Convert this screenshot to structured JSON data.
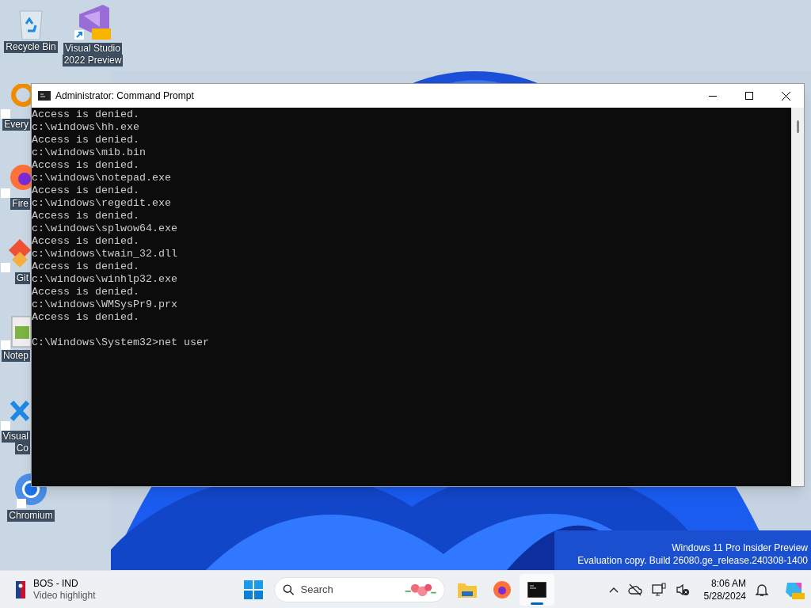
{
  "desktop_icons": [
    {
      "kind": "recycle",
      "lines": [
        "Recycle Bin"
      ]
    },
    {
      "kind": "vs",
      "lines": [
        "Visual Studio",
        "2022 Preview"
      ]
    },
    {
      "kind": "everything",
      "lines": [
        "Every"
      ]
    },
    {
      "kind": "firefox",
      "lines": [
        "Fire"
      ]
    },
    {
      "kind": "git",
      "lines": [
        "Git"
      ]
    },
    {
      "kind": "notepad",
      "lines": [
        "Notep"
      ]
    },
    {
      "kind": "vscode",
      "lines": [
        "Visual",
        "Co"
      ]
    },
    {
      "kind": "chromium",
      "lines": [
        "Chromium"
      ]
    }
  ],
  "window": {
    "title": "Administrator: Command Prompt",
    "lines": [
      "Access is denied.",
      "c:\\windows\\hh.exe",
      "Access is denied.",
      "c:\\windows\\mib.bin",
      "Access is denied.",
      "c:\\windows\\notepad.exe",
      "Access is denied.",
      "c:\\windows\\regedit.exe",
      "Access is denied.",
      "c:\\windows\\splwow64.exe",
      "Access is denied.",
      "c:\\windows\\twain_32.dll",
      "Access is denied.",
      "c:\\windows\\winhlp32.exe",
      "Access is denied.",
      "c:\\windows\\WMSysPr9.prx",
      "Access is denied."
    ],
    "prompt": "C:\\Windows\\System32>net user"
  },
  "watermark": [
    "Windows 11 Pro Insider Preview",
    "Evaluation copy. Build 26080.ge_release.240308-1400"
  ],
  "taskbar": {
    "widget": {
      "title": "BOS - IND",
      "subtitle": "Video highlight"
    },
    "search": {
      "placeholder": "Search"
    },
    "apps": [
      {
        "kind": "explorer",
        "selected": false
      },
      {
        "kind": "firefox",
        "selected": false
      },
      {
        "kind": "terminal",
        "selected": true
      }
    ],
    "time": "8:06 AM",
    "date": "5/28/2024"
  }
}
